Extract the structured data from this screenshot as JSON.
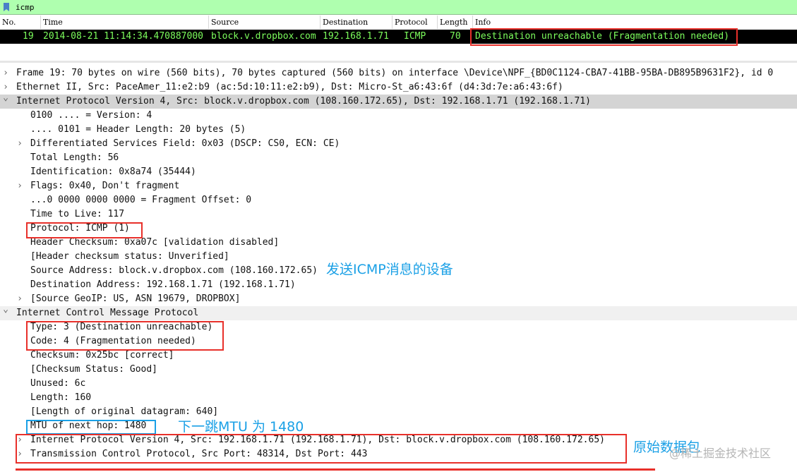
{
  "filter": {
    "value": "icmp"
  },
  "columns": [
    "No.",
    "Time",
    "Source",
    "Destination",
    "Protocol",
    "Length",
    "Info"
  ],
  "packet": {
    "no": "19",
    "time": "2014-08-21 11:14:34.470887000",
    "source": "block.v.dropbox.com",
    "destination": "192.168.1.71",
    "protocol": "ICMP",
    "length": "70",
    "info": "Destination unreachable (Fragmentation needed)"
  },
  "tree": [
    {
      "text": "Frame 19: 70 bytes on wire (560 bits), 70 bytes captured (560 bits) on interface \\Device\\NPF_{BD0C1124-CBA7-41BB-95BA-DB895B9631F2}, id 0",
      "arrow": "collapsed"
    },
    {
      "text": "Ethernet II, Src: PaceAmer_11:e2:b9 (ac:5d:10:11:e2:b9), Dst: Micro-St_a6:43:6f (d4:3d:7e:a6:43:6f)",
      "arrow": "collapsed"
    },
    {
      "text": "Internet Protocol Version 4, Src: block.v.dropbox.com (108.160.172.65), Dst: 192.168.1.71 (192.168.1.71)",
      "arrow": "expanded"
    },
    {
      "text": "0100 .... = Version: 4",
      "arrow": ""
    },
    {
      "text": ".... 0101 = Header Length: 20 bytes (5)",
      "arrow": ""
    },
    {
      "text": "Differentiated Services Field: 0x03 (DSCP: CS0, ECN: CE)",
      "arrow": "collapsed"
    },
    {
      "text": "Total Length: 56",
      "arrow": ""
    },
    {
      "text": "Identification: 0x8a74 (35444)",
      "arrow": ""
    },
    {
      "text": "Flags: 0x40, Don't fragment",
      "arrow": "collapsed"
    },
    {
      "text": "...0 0000 0000 0000 = Fragment Offset: 0",
      "arrow": ""
    },
    {
      "text": "Time to Live: 117",
      "arrow": ""
    },
    {
      "text": "Protocol: ICMP (1)",
      "arrow": ""
    },
    {
      "text": "Header Checksum: 0xa07c [validation disabled]",
      "arrow": ""
    },
    {
      "text": "[Header checksum status: Unverified]",
      "arrow": ""
    },
    {
      "text": "Source Address: block.v.dropbox.com (108.160.172.65)",
      "arrow": ""
    },
    {
      "text": "Destination Address: 192.168.1.71 (192.168.1.71)",
      "arrow": ""
    },
    {
      "text": "[Source GeoIP: US, ASN 19679, DROPBOX]",
      "arrow": "collapsed"
    },
    {
      "text": "Internet Control Message Protocol",
      "arrow": "expanded"
    },
    {
      "text": "Type: 3 (Destination unreachable)",
      "arrow": ""
    },
    {
      "text": "Code: 4 (Fragmentation needed)",
      "arrow": ""
    },
    {
      "text": "Checksum: 0x25bc [correct]",
      "arrow": ""
    },
    {
      "text": "[Checksum Status: Good]",
      "arrow": ""
    },
    {
      "text": "Unused: 6c",
      "arrow": ""
    },
    {
      "text": "Length: 160",
      "arrow": ""
    },
    {
      "text": "[Length of original datagram: 640]",
      "arrow": ""
    },
    {
      "text": "MTU of next hop: 1480",
      "arrow": ""
    },
    {
      "text": "Internet Protocol Version 4, Src: 192.168.1.71 (192.168.1.71), Dst: block.v.dropbox.com (108.160.172.65)",
      "arrow": "collapsed"
    },
    {
      "text": "Transmission Control Protocol, Src Port: 48314, Dst Port: 443",
      "arrow": "collapsed"
    }
  ],
  "annotations": {
    "sender_device": "发送ICMP消息的设备",
    "next_hop_mtu": "下一跳MTU 为 1480",
    "original_packet": "原始数据包",
    "watermark": "@稀土掘金技术社区"
  },
  "colors": {
    "filter_bg": "#afffaf",
    "packet_fg": "#7cfc5c",
    "red_box": "#e8302a",
    "blue_box": "#1aa0e6",
    "note_blue": "#1aa0e6"
  }
}
